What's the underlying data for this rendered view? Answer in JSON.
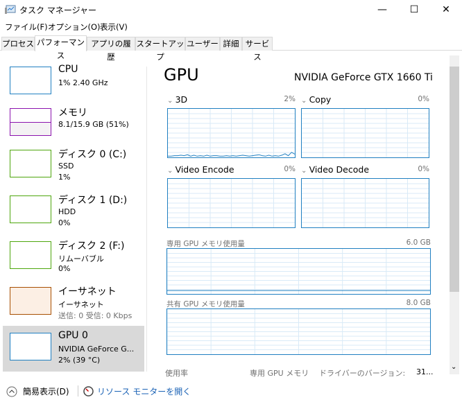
{
  "window": {
    "title": "タスク マネージャー",
    "minimize": "—",
    "maximize": "☐",
    "close": "✕"
  },
  "menu": [
    "ファイル(F)",
    "オプション(O)",
    "表示(V)"
  ],
  "tabs": [
    "プロセス",
    "パフォーマンス",
    "アプリの履歴",
    "スタートアップ",
    "ユーザー",
    "詳細",
    "サービス"
  ],
  "sidebar": [
    {
      "name": "CPU",
      "line1": "1%  2.40 GHz",
      "line2": "",
      "color": "#1f7fc1"
    },
    {
      "name": "メモリ",
      "line1": "8.1/15.9 GB (51%)",
      "line2": "",
      "color": "#8b12ae"
    },
    {
      "name": "ディスク 0 (C:)",
      "line1": "SSD",
      "line2": "1%",
      "color": "#4da60c"
    },
    {
      "name": "ディスク 1 (D:)",
      "line1": "HDD",
      "line2": "0%",
      "color": "#4da60c"
    },
    {
      "name": "ディスク 2 (F:)",
      "line1": "リムーバブル",
      "line2": "0%",
      "color": "#4da60c"
    },
    {
      "name": "イーサネット",
      "line1": "イーサネット",
      "line2": "送信: 0 受信: 0 Kbps",
      "color": "#a74f01"
    },
    {
      "name": "GPU 0",
      "line1": "NVIDIA GeForce G...",
      "line2": "2%  (39 °C)",
      "color": "#1f7fc1"
    }
  ],
  "main": {
    "title": "GPU",
    "model": "NVIDIA GeForce GTX 1660 Ti",
    "engines": [
      {
        "label": "3D",
        "pct": "2%",
        "values": [
          1,
          1,
          2,
          2,
          3,
          2,
          4,
          1,
          3,
          1,
          2,
          1,
          3,
          1,
          2,
          2,
          1,
          1,
          2,
          1,
          2,
          1,
          2,
          3,
          2,
          1,
          2,
          3,
          4,
          2,
          1,
          3,
          1,
          2,
          1,
          3,
          6,
          2,
          9,
          5
        ]
      },
      {
        "label": "Copy",
        "pct": "0%",
        "values": []
      },
      {
        "label": "Video Encode",
        "pct": "0%",
        "values": []
      },
      {
        "label": "Video Decode",
        "pct": "0%",
        "values": []
      }
    ],
    "dedicated_label": "専用 GPU メモリ使用量",
    "dedicated_max": "6.0 GB",
    "shared_label": "共有 GPU メモリ使用量",
    "shared_max": "8.0 GB",
    "stats": {
      "usage": "使用率",
      "dedicated": "専用 GPU メモリ",
      "driver_label": "ドライバーのバージョン:",
      "driver_value": "31..."
    }
  },
  "footer": {
    "fewer": "簡易表示(D)",
    "monitor": "リソース モニターを開く"
  },
  "accent": "#1f7fc1"
}
